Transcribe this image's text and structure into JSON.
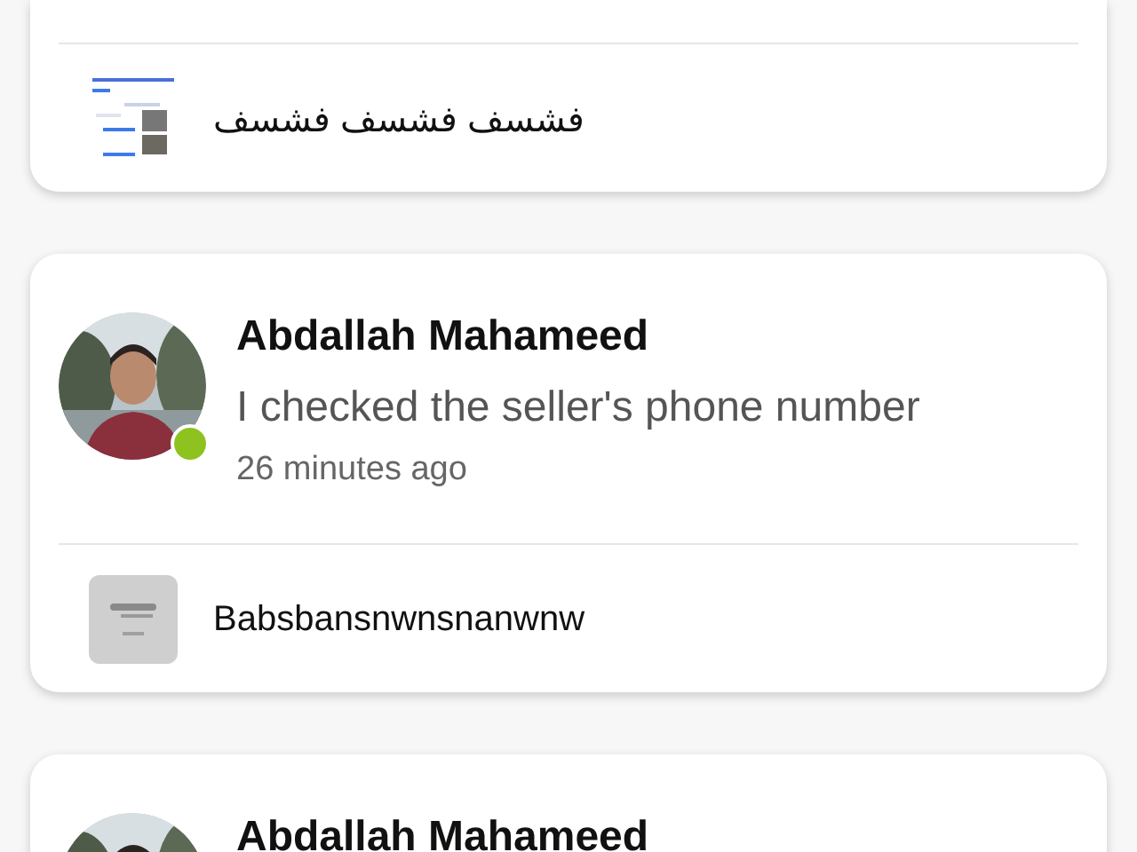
{
  "conversations": [
    {
      "kind": "cut",
      "listing": {
        "title": "فشسف فشسف فشسف"
      }
    },
    {
      "kind": "full",
      "sender": {
        "name": "Abdallah Mahameed",
        "online": true
      },
      "message": "I checked the seller's phone number",
      "time": "26 minutes ago",
      "listing": {
        "title": "Babsbansnwnsnanwnw"
      }
    },
    {
      "kind": "full",
      "sender": {
        "name": "Abdallah Mahameed"
      }
    }
  ]
}
